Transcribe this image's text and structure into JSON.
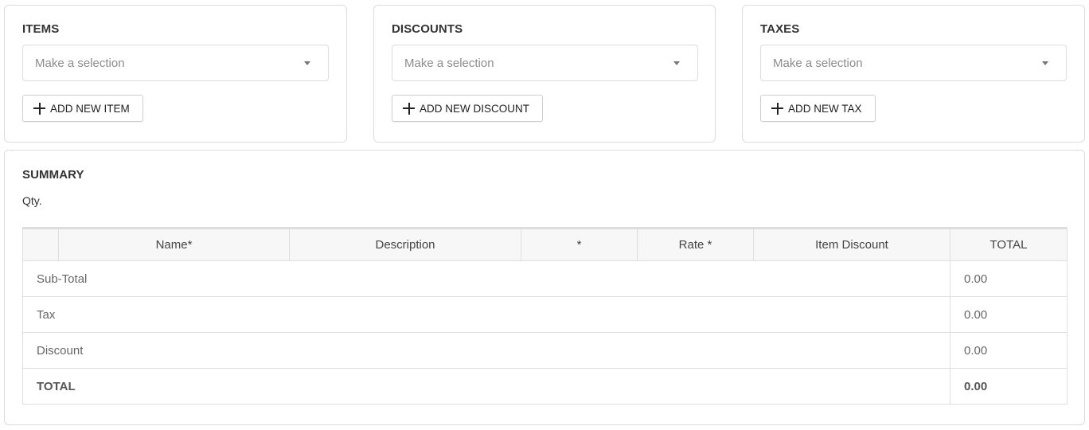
{
  "items": {
    "title": "ITEMS",
    "placeholder": "Make a selection",
    "add_label": "ADD NEW ITEM"
  },
  "discounts": {
    "title": "DISCOUNTS",
    "placeholder": "Make a selection",
    "add_label": "ADD NEW DISCOUNT"
  },
  "taxes": {
    "title": "TAXES",
    "placeholder": "Make a selection",
    "add_label": "ADD NEW TAX"
  },
  "summary": {
    "title": "SUMMARY",
    "qty_label": "Qty.",
    "columns": [
      "",
      "Name*",
      "Description",
      "*",
      "Rate *",
      "Item Discount",
      "TOTAL"
    ],
    "rows": [
      {
        "label": "Sub-Total",
        "value": "0.00"
      },
      {
        "label": "Tax",
        "value": "0.00"
      },
      {
        "label": "Discount",
        "value": "0.00"
      },
      {
        "label": "TOTAL",
        "value": "0.00"
      }
    ]
  },
  "colors": {
    "border": "#dcdcdc",
    "header_bg": "#f7f7f7",
    "placeholder": "#8c8c8c"
  },
  "icons": [
    "plus-icon",
    "caret-down-icon"
  ]
}
